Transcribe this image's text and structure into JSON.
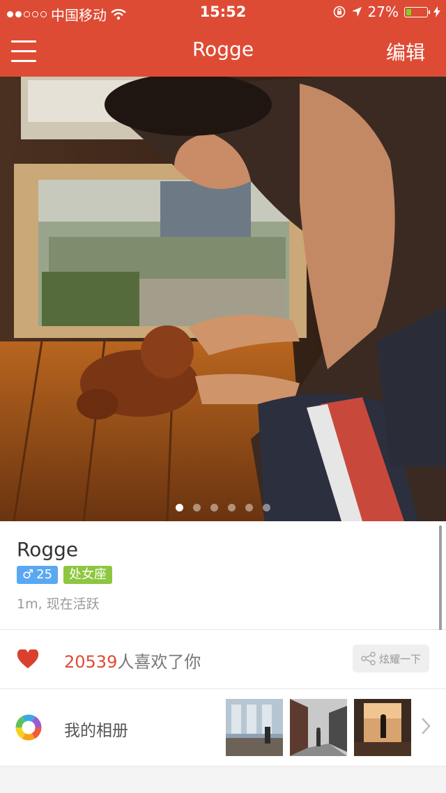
{
  "status_bar": {
    "carrier": "中国移动",
    "time": "15:52",
    "battery": "27%",
    "battery_level": 0.27
  },
  "navbar": {
    "title": "Rogge",
    "edit_label": "编辑"
  },
  "photo_pager": {
    "count": 6,
    "active_index": 0
  },
  "profile": {
    "name": "Rogge",
    "gender_symbol": "♂",
    "age": "25",
    "zodiac": "处女座",
    "distance_status": "1m, 现在活跃"
  },
  "likes": {
    "count": "20539",
    "suffix": "人喜欢了你",
    "share_label": "炫耀一下"
  },
  "album": {
    "label": "我的相册",
    "thumbnails": [
      "city-window",
      "street-walk",
      "window-silhouette"
    ]
  },
  "colors": {
    "brand": "#de4b35",
    "gender_badge": "#5aa8f2",
    "zodiac_badge": "#8dc63f",
    "like_count": "#de4b35"
  }
}
